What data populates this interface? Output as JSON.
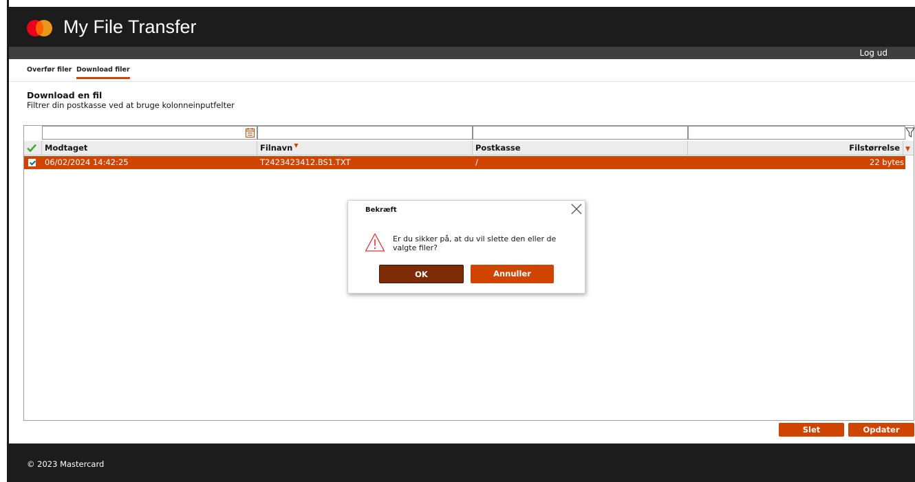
{
  "app": {
    "title": "My File Transfer"
  },
  "subbar": {
    "logout_label": "Log ud"
  },
  "tabs": [
    {
      "label": "Overfør filer",
      "active": false
    },
    {
      "label": "Download filer",
      "active": true
    }
  ],
  "section": {
    "title": "Download en fil",
    "subtitle": "Filtrer din postkasse ved at bruge kolonneinputfelter"
  },
  "table": {
    "filters": [
      "",
      "",
      "",
      ""
    ],
    "columns": [
      "Modtaget",
      "Filnavn",
      "Postkasse",
      "Filstørrelse"
    ],
    "sort_mark": "▼",
    "rows": [
      {
        "selected": true,
        "received": "06/02/2024 14:42:25",
        "filename": "T2423423412.BS1.TXT",
        "mailbox": "/",
        "size": "22 bytes"
      }
    ]
  },
  "dialog": {
    "title": "Bekræft",
    "message": "Er du sikker på, at du vil slette den eller de valgte filer?",
    "ok_label": "OK",
    "cancel_label": "Annuller"
  },
  "actions": {
    "delete_label": "Slet",
    "refresh_label": "Opdater"
  },
  "footer": {
    "copyright": "© 2023 Mastercard"
  },
  "colors": {
    "accent": "#cf4500",
    "ok_button": "#7e2c08",
    "header_bg": "#1c1c1c",
    "check_green": "#3da838"
  },
  "icons": [
    "mastercard-logo",
    "calendar-icon",
    "filter-funnel-icon",
    "check-all-icon",
    "close-icon",
    "warning-icon"
  ]
}
